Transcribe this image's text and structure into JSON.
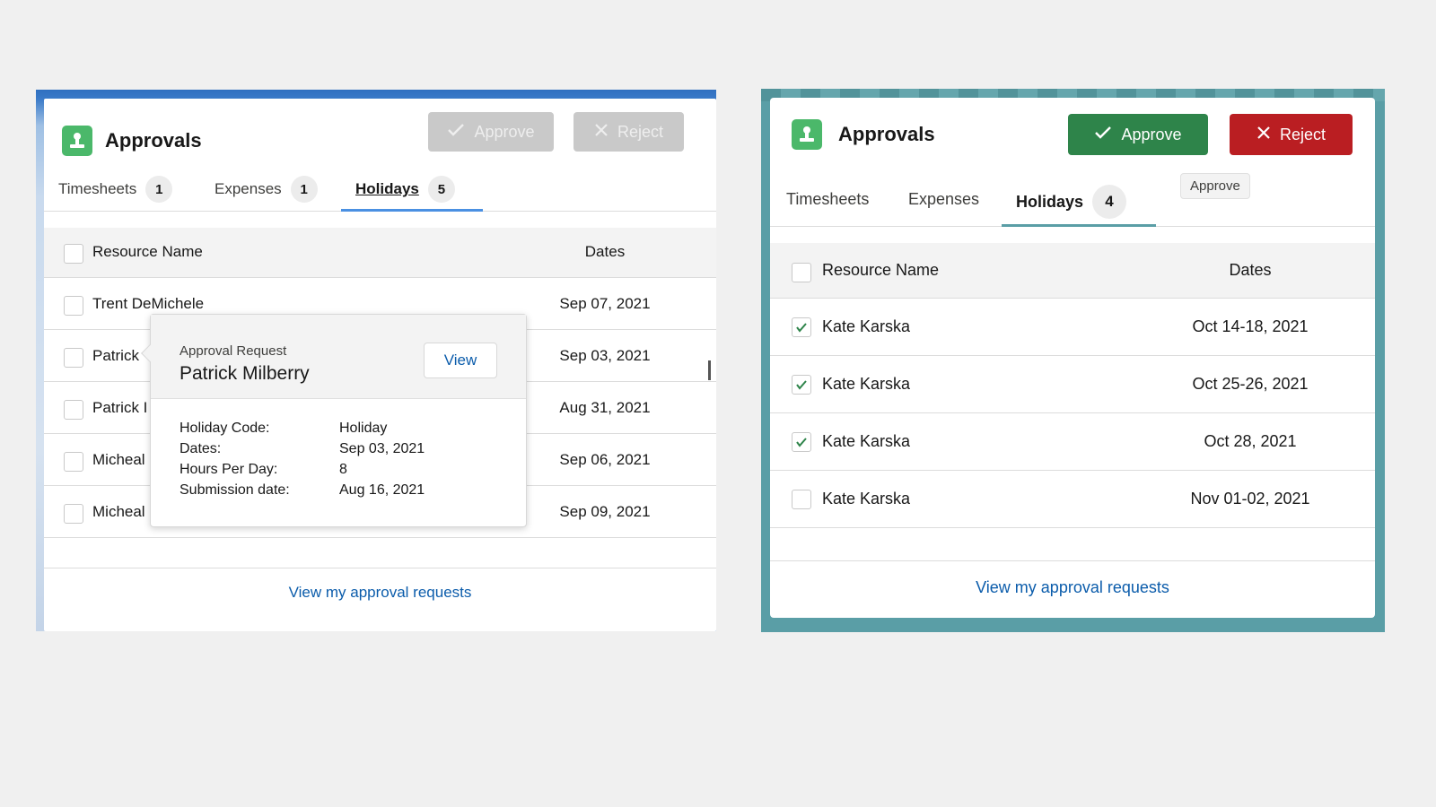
{
  "left_panel": {
    "title": "Approvals",
    "approve_label": "Approve",
    "reject_label": "Reject",
    "tabs": [
      {
        "label": "Timesheets",
        "count": "1"
      },
      {
        "label": "Expenses",
        "count": "1"
      },
      {
        "label": "Holidays",
        "count": "5"
      }
    ],
    "columns": {
      "name": "Resource Name",
      "dates": "Dates"
    },
    "rows": [
      {
        "name": "Trent DeMichele",
        "date": "Sep 07, 2021"
      },
      {
        "name": "Patrick",
        "date": "Sep 03, 2021"
      },
      {
        "name": "Patrick I",
        "date": "Aug 31, 2021"
      },
      {
        "name": "Micheal",
        "date": "Sep 06, 2021"
      },
      {
        "name": "Micheal",
        "date": "Sep 09, 2021"
      }
    ],
    "popover": {
      "label": "Approval Request",
      "name": "Patrick Milberry",
      "view_label": "View",
      "fields": [
        {
          "key": "Holiday Code:",
          "value": "Holiday"
        },
        {
          "key": "Dates:",
          "value": "Sep 03, 2021"
        },
        {
          "key": "Hours Per Day:",
          "value": "8"
        },
        {
          "key": "Submission date:",
          "value": "Aug 16, 2021"
        }
      ]
    },
    "footer_link": "View my approval requests"
  },
  "right_panel": {
    "title": "Approvals",
    "approve_label": "Approve",
    "reject_label": "Reject",
    "tooltip": "Approve",
    "tabs": [
      {
        "label": "Timesheets"
      },
      {
        "label": "Expenses"
      },
      {
        "label": "Holidays",
        "count": "4"
      }
    ],
    "columns": {
      "name": "Resource Name",
      "dates": "Dates"
    },
    "rows": [
      {
        "name": "Kate Karska",
        "date": "Oct 14-18, 2021",
        "checked": true
      },
      {
        "name": "Kate Karska",
        "date": "Oct 25-26, 2021",
        "checked": true
      },
      {
        "name": "Kate Karska",
        "date": "Oct 28, 2021",
        "checked": true
      },
      {
        "name": "Kate Karska",
        "date": "Nov 01-02, 2021",
        "checked": false
      }
    ],
    "footer_link": "View my approval requests"
  },
  "colors": {
    "approve_green": "#2e844a",
    "reject_red": "#ba1e22",
    "link_blue": "#0b5cab",
    "icon_green": "#4bb86a",
    "left_tab_accent": "#4a90e2",
    "right_tab_accent": "#5a9ea6"
  }
}
